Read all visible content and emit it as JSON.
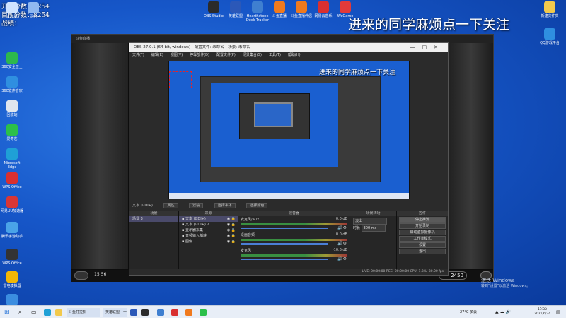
{
  "desktop": {
    "overlay_lines": [
      "开始分数：8254",
      "目前分数：8254",
      "战绩："
    ],
    "banner": "进来的同学麻烦点一下关注",
    "left_icons": [
      {
        "label": "此电脑",
        "color": "#cfe3ff"
      },
      {
        "label": "网络",
        "color": "#8fb8f0"
      },
      {
        "label": "360安全卫士",
        "color": "#2db84d"
      },
      {
        "label": "360软件管家",
        "color": "#2f8fe0"
      },
      {
        "label": "回收站",
        "color": "#e0e6ee"
      },
      {
        "label": "爱奇艺",
        "color": "#2cc04a"
      },
      {
        "label": "Microsoft Edge",
        "color": "#1fa0d6"
      },
      {
        "label": "WPS Office",
        "color": "#d93030"
      },
      {
        "label": "网易UU加速器",
        "color": "#d93636"
      },
      {
        "label": "腾讯手游助手",
        "color": "#4aa3e8"
      },
      {
        "label": "WPS Office",
        "color": "#333333"
      },
      {
        "label": "雷电模拟器",
        "color": "#f2b705"
      },
      {
        "label": "百度网盘",
        "color": "#3b8de0"
      }
    ],
    "top_icons": [
      {
        "label": "OBS Studio",
        "color": "#2b2b2b"
      },
      {
        "label": "英雄联盟",
        "color": "#2b58b8"
      },
      {
        "label": "Hearthstone Deck Tracker",
        "color": "#3f7fd0"
      },
      {
        "label": "斗鱼直播",
        "color": "#f07a1e"
      },
      {
        "label": "斗鱼直播伴侣",
        "color": "#f07a1e"
      },
      {
        "label": "网易云音乐",
        "color": "#d93030"
      },
      {
        "label": "WeGame",
        "color": "#e23a3a"
      }
    ],
    "right_icons": [
      {
        "label": "新建文件夹",
        "color": "#f2c94c"
      },
      {
        "label": "QQ游戏平台",
        "color": "#2f8fe0"
      }
    ]
  },
  "stream_window": {
    "title": "斗鱼直播",
    "time": "15:56",
    "gold": "2450"
  },
  "obs": {
    "title": "OBS 27.0.1 (64-bit, windows) - 配置文件: 未命名 - 场景: 未命名",
    "menu": [
      "文件(F)",
      "编辑(E)",
      "视图(V)",
      "停靠部件(D)",
      "配置文件(P)",
      "场景集合(S)",
      "工具(T)",
      "帮助(H)"
    ],
    "preview_banner": "进来的同学麻烦点一下关注",
    "selected_source": "文本 (GDI+)",
    "source_bar_buttons": [
      "属性",
      "滤镜",
      "选择字体",
      "选择颜色"
    ],
    "docks": {
      "scenes": {
        "header": "场景",
        "items": [
          "场景 3"
        ]
      },
      "sources": {
        "header": "来源",
        "items": [
          "文本 (GDI+)",
          "文本 (GDI+) 2",
          "显示器采集",
          "音频输入捕获",
          "图像"
        ]
      },
      "mixer": {
        "header": "混音器",
        "tracks": [
          {
            "name": "麦克风/Aux",
            "db": "0.0 dB"
          },
          {
            "name": "桌面音频",
            "db": "0.0 dB"
          },
          {
            "name": "麦克风",
            "db": "-10.6 dB"
          }
        ]
      },
      "transitions": {
        "header": "场景转场",
        "type": "淡出",
        "duration_label": "时长",
        "duration": "300 ms"
      },
      "controls": {
        "header": "控件",
        "buttons": [
          "停止推流",
          "开始录制",
          "启动虚拟摄像机",
          "工作室模式",
          "设置",
          "退出"
        ]
      }
    },
    "status": "LIVE: 00:00:00   REC: 00:00:00   CPU: 1.3%, 30.00 fps"
  },
  "taskbar": {
    "search_icon": "search-icon",
    "items": [
      "斗鱼打拉机",
      "英雄联盟 - 一..."
    ],
    "weather": "27°C 多云",
    "time": "15:55",
    "date": "2021/6/24"
  },
  "activate_windows": {
    "title": "激活 Windows",
    "subtitle": "转到“设置”以激活 Windows。"
  }
}
